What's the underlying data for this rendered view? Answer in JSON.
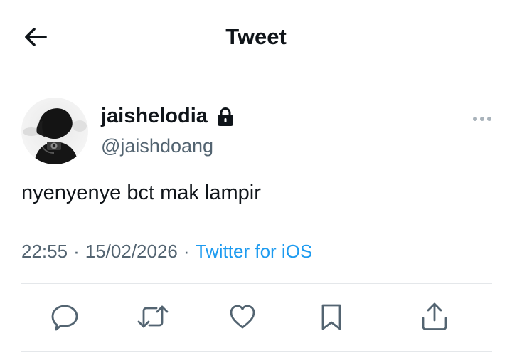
{
  "header": {
    "title": "Tweet"
  },
  "tweet": {
    "display_name": "jaishelodia",
    "handle": "@jaishdoang",
    "text": "nyenyenye bct mak lampir",
    "time": "22:55",
    "date": "15/02/2026",
    "separator": "·",
    "source": "Twitter for iOS"
  },
  "icons": {
    "back": "arrow-left-icon",
    "lock": "lock-icon",
    "more": "more-horizontal-icon",
    "reply": "reply-icon",
    "retweet": "retweet-icon",
    "like": "heart-icon",
    "bookmark": "bookmark-icon",
    "share": "share-icon"
  },
  "colors": {
    "text_primary": "#0f1419",
    "text_secondary": "#536471",
    "link": "#1d9bf0",
    "divider": "#e4e7ea"
  }
}
